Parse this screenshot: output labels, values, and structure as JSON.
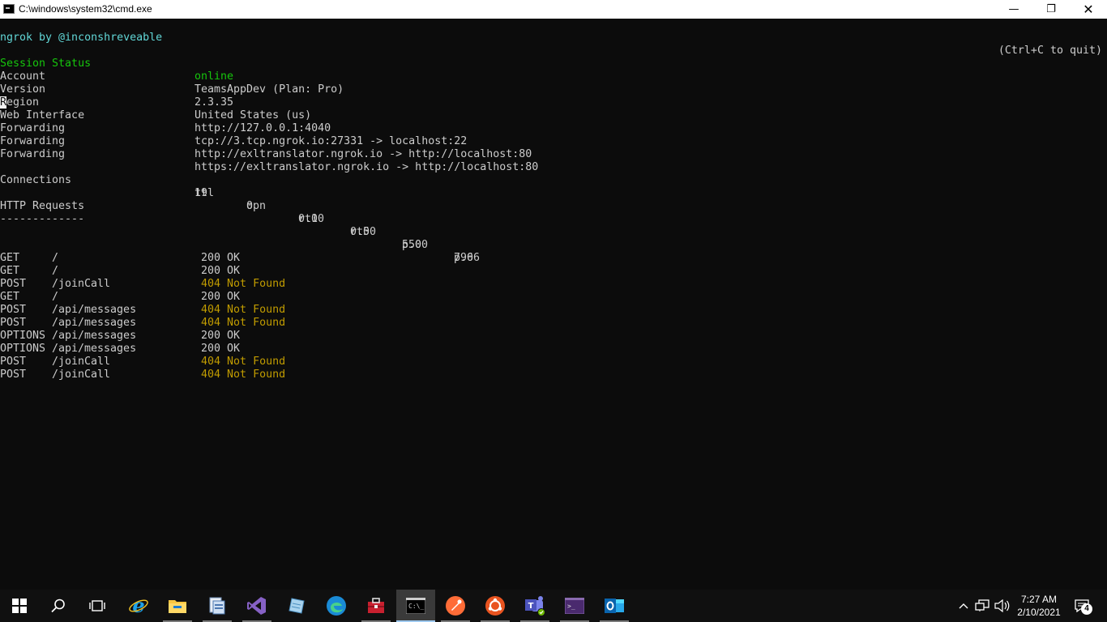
{
  "window": {
    "title": "C:\\windows\\system32\\cmd.exe",
    "min_glyph": "—",
    "restore_glyph": "❐",
    "close_glyph": "✕"
  },
  "console": {
    "header_left": "ngrok by @inconshreveable",
    "header_right": "(Ctrl+C to quit)",
    "status_label": "Session Status",
    "status_value": "online",
    "info": [
      {
        "label": "Account",
        "value": "TeamsAppDev (Plan: Pro)"
      },
      {
        "label": "Version",
        "value": "2.3.35"
      },
      {
        "label_cursor": "R",
        "label": "egion",
        "value": "United States (us)"
      },
      {
        "label": "Web Interface",
        "value": "http://127.0.0.1:4040"
      },
      {
        "label": "Forwarding",
        "value": "tcp://3.tcp.ngrok.io:27331 -> localhost:22"
      },
      {
        "label": "Forwarding",
        "value": "http://exltranslator.ngrok.io -> http://localhost:80"
      },
      {
        "label": "Forwarding",
        "value": "https://exltranslator.ngrok.io -> http://localhost:80"
      }
    ],
    "connections": {
      "label": "Connections",
      "headers": [
        "ttl",
        "opn",
        "rt1",
        "rt5",
        "p50",
        "p90"
      ],
      "values": [
        "19",
        "0",
        "0.00",
        "0.00",
        "5.00",
        "7.66"
      ]
    },
    "requests_title": "HTTP Requests",
    "requests_rule": "-------------",
    "requests": [
      {
        "method": "GET",
        "path": "/",
        "code": "200",
        "text": "OK"
      },
      {
        "method": "GET",
        "path": "/",
        "code": "200",
        "text": "OK"
      },
      {
        "method": "POST",
        "path": "/joinCall",
        "code": "404",
        "text": "Not Found"
      },
      {
        "method": "GET",
        "path": "/",
        "code": "200",
        "text": "OK"
      },
      {
        "method": "POST",
        "path": "/api/messages",
        "code": "404",
        "text": "Not Found"
      },
      {
        "method": "POST",
        "path": "/api/messages",
        "code": "404",
        "text": "Not Found"
      },
      {
        "method": "OPTIONS",
        "path": "/api/messages",
        "code": "200",
        "text": "OK"
      },
      {
        "method": "OPTIONS",
        "path": "/api/messages",
        "code": "200",
        "text": "OK"
      },
      {
        "method": "POST",
        "path": "/joinCall",
        "code": "404",
        "text": "Not Found"
      },
      {
        "method": "POST",
        "path": "/joinCall",
        "code": "404",
        "text": "Not Found"
      }
    ]
  },
  "colors": {
    "online": "#16c60c",
    "header_cyan": "#61d6d6",
    "not_found": "#c19c00",
    "console_bg": "#0c0c0c",
    "taskbar_bg": "#101010"
  },
  "taskbar": {
    "apps": [
      "windows-start-icon",
      "search-icon",
      "task-view-icon",
      "internet-explorer-icon",
      "file-explorer-icon",
      "file-manager-icon",
      "visual-studio-icon",
      "notepad-icon",
      "edge-icon",
      "toolbox-icon",
      "cmd-icon",
      "postman-icon",
      "ubuntu-icon",
      "teams-icon",
      "terminal-icon",
      "outlook-icon"
    ],
    "time": "7:27 AM",
    "date": "2/10/2021",
    "notification_count": "4"
  }
}
